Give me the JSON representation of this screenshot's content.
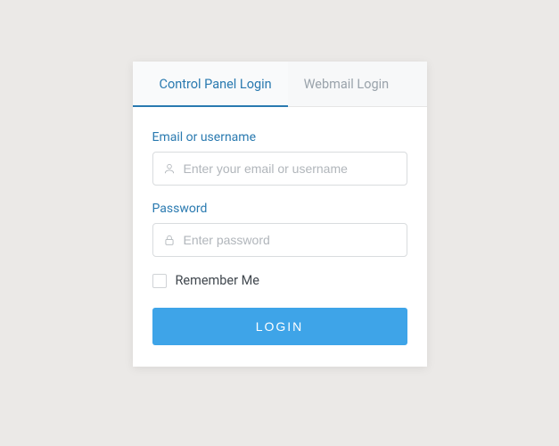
{
  "tabs": {
    "control_panel": "Control Panel Login",
    "webmail": "Webmail Login"
  },
  "fields": {
    "email": {
      "label": "Email or username",
      "placeholder": "Enter your email or username"
    },
    "password": {
      "label": "Password",
      "placeholder": "Enter password"
    }
  },
  "remember_label": "Remember Me",
  "login_button": "LOGIN"
}
